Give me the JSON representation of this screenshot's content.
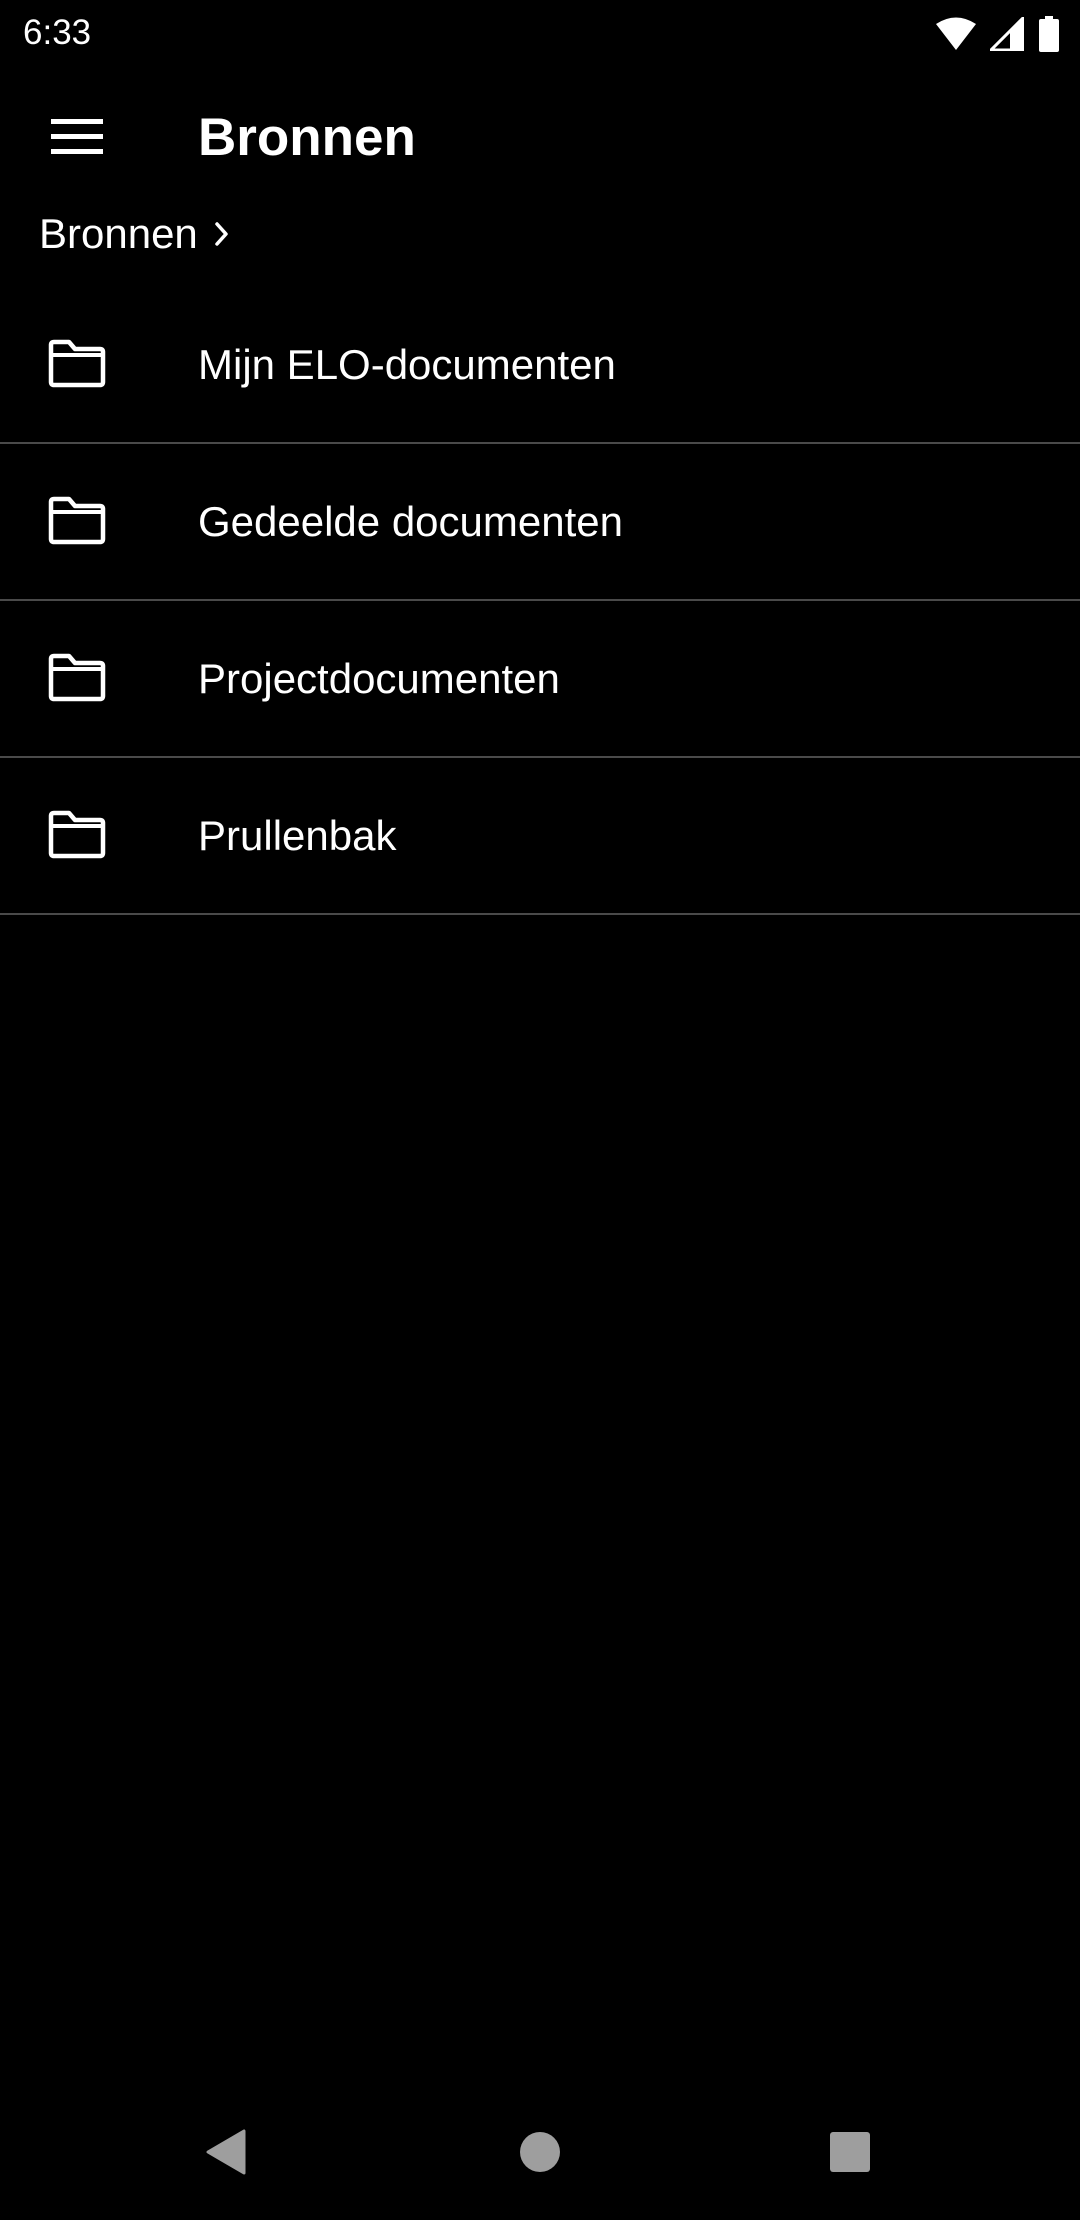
{
  "status_bar": {
    "time": "6:33",
    "icons": [
      "wifi-icon",
      "cell-signal-icon",
      "battery-icon"
    ]
  },
  "app_bar": {
    "menu_icon": "hamburger-menu-icon",
    "title": "Bronnen"
  },
  "breadcrumb": {
    "items": [
      {
        "label": "Bronnen"
      }
    ],
    "separator_icon": "chevron-right-icon"
  },
  "folders": [
    {
      "label": "Mijn ELO-documenten",
      "icon": "folder-icon"
    },
    {
      "label": "Gedeelde documenten",
      "icon": "folder-icon"
    },
    {
      "label": "Projectdocumenten",
      "icon": "folder-icon"
    },
    {
      "label": "Prullenbak",
      "icon": "folder-icon"
    }
  ],
  "navigation_bar": {
    "buttons": [
      "back-icon",
      "home-icon",
      "recents-icon"
    ]
  },
  "colors": {
    "background": "#000000",
    "text": "#ffffff",
    "divider": "#4a4a4a",
    "nav_icon": "#9e9e9e"
  }
}
